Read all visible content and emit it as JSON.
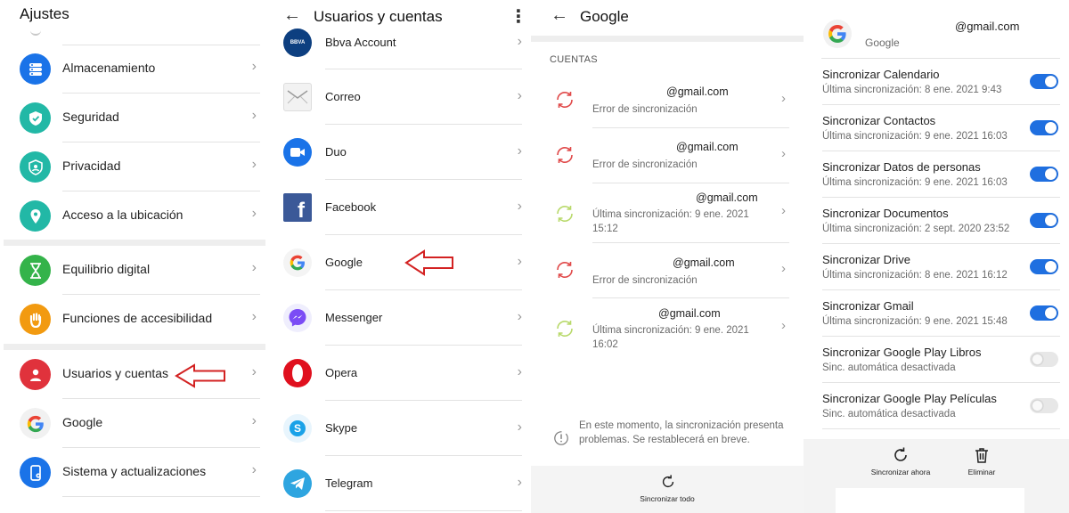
{
  "ajustes": {
    "title": "Ajustes",
    "items": [
      {
        "label": "Almacenamiento",
        "icon": "storage-icon",
        "color": "#1a73e8"
      },
      {
        "label": "Seguridad",
        "icon": "shield-icon",
        "color": "#22b8a6"
      },
      {
        "label": "Privacidad",
        "icon": "privacy-icon",
        "color": "#22b8a6"
      },
      {
        "label": "Acceso a la ubicación",
        "icon": "location-icon",
        "color": "#22b8a6"
      },
      {
        "label": "Equilibrio digital",
        "icon": "hourglass-icon",
        "color": "#34b34a"
      },
      {
        "label": "Funciones de accesibilidad",
        "icon": "hand-icon",
        "color": "#f29a10"
      },
      {
        "label": "Usuarios y cuentas",
        "icon": "user-icon",
        "color": "#e0323c"
      },
      {
        "label": "Google",
        "icon": "google-icon",
        "color": "#4285f4"
      },
      {
        "label": "Sistema y actualizaciones",
        "icon": "phone-settings-icon",
        "color": "#1a73e8"
      }
    ]
  },
  "usuarios": {
    "title": "Usuarios y cuentas",
    "items": [
      {
        "label": "Bbva Account",
        "icon": "bbva-icon",
        "badge": "BBVA"
      },
      {
        "label": "Correo",
        "icon": "mail-icon"
      },
      {
        "label": "Duo",
        "icon": "duo-icon"
      },
      {
        "label": "Facebook",
        "icon": "facebook-icon",
        "badge": "f"
      },
      {
        "label": "Google",
        "icon": "google-icon"
      },
      {
        "label": "Messenger",
        "icon": "messenger-icon"
      },
      {
        "label": "Opera",
        "icon": "opera-icon"
      },
      {
        "label": "Skype",
        "icon": "skype-icon",
        "badge": "S"
      },
      {
        "label": "Telegram",
        "icon": "telegram-icon"
      }
    ]
  },
  "google_accounts": {
    "title": "Google",
    "section": "CUENTAS",
    "accounts": [
      {
        "email": "@gmail.com",
        "status": "Error de sincronización",
        "state": "error"
      },
      {
        "email": "@gmail.com",
        "status": "Error de sincronización",
        "state": "error"
      },
      {
        "email": "@gmail.com",
        "status": "Última sincronización: 9 ene. 2021 15:12",
        "state": "ok"
      },
      {
        "email": "@gmail.com",
        "status": "Error de sincronización",
        "state": "error"
      },
      {
        "email": "@gmail.com",
        "status": "Última sincronización: 9 ene. 2021 16:02",
        "state": "ok"
      }
    ],
    "warning": "En este momento, la sincronización presenta problemas. Se restablecerá en breve.",
    "sync_all": "Sincronizar todo"
  },
  "google_sync": {
    "email": "@gmail.com",
    "provider": "Google",
    "items": [
      {
        "title": "Sincronizar Calendario",
        "status": "Última sincronización: 8 ene. 2021 9:43",
        "on": true
      },
      {
        "title": "Sincronizar Contactos",
        "status": "Última sincronización: 9 ene. 2021 16:03",
        "on": true
      },
      {
        "title": "Sincronizar Datos de personas",
        "status": "Última sincronización: 9 ene. 2021 16:03",
        "on": true
      },
      {
        "title": "Sincronizar Documentos",
        "status": "Última sincronización: 2 sept. 2020 23:52",
        "on": true
      },
      {
        "title": "Sincronizar Drive",
        "status": "Última sincronización: 8 ene. 2021 16:12",
        "on": true
      },
      {
        "title": "Sincronizar Gmail",
        "status": "Última sincronización: 9 ene. 2021 15:48",
        "on": true
      },
      {
        "title": "Sincronizar Google Play Libros",
        "status": "Sinc. automática desactivada",
        "on": false
      },
      {
        "title": "Sincronizar Google Play Películas",
        "status": "Sinc. automática desactivada",
        "on": false
      }
    ],
    "sync_now": "Sincronizar ahora",
    "delete": "Eliminar"
  },
  "colors": {
    "toggle_on": "#1f6fe0",
    "annotation_arrow": "#d32222",
    "error": "#e04848",
    "ok": "#b8d96a"
  }
}
